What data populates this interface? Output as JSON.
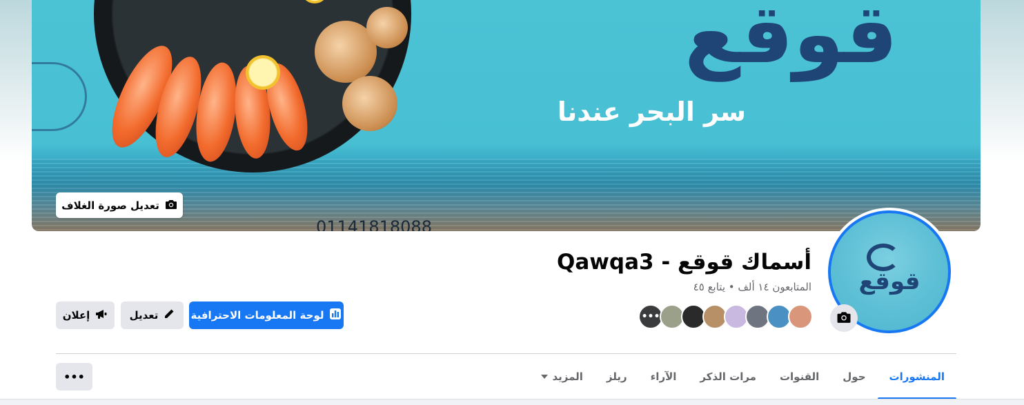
{
  "cover": {
    "logo_word": "قوقع",
    "tagline": "سر البحر عندنا",
    "phone": "01141818088",
    "edit_button_label": "تعديل صورة الغلاف",
    "edit_button_icon": "camera-icon"
  },
  "profile": {
    "avatar_mark": "قوقع",
    "avatar_camera_icon": "camera-icon",
    "name": "أسماك قوقع - Qawqa3",
    "followers_text": "المتابعون ١٤ ألف • يتابع ٤٥"
  },
  "friend_avatars": {
    "count_shown": 8,
    "more_label": "•••",
    "colors": [
      "#d9967a",
      "#4a90c2",
      "#6e7580",
      "#c9b8e0",
      "#b89068",
      "#2a2a2a",
      "#9aa08a",
      "#5a5e63"
    ]
  },
  "actions": {
    "dashboard_label": "لوحة المعلومات الاحترافية",
    "dashboard_icon": "chart-icon",
    "edit_label": "تعديل",
    "edit_icon": "pencil-icon",
    "ad_label": "إعلان",
    "ad_icon": "megaphone-icon",
    "primary_color": "#1877f2"
  },
  "tabs": [
    {
      "label": "المنشورات",
      "active": true
    },
    {
      "label": "حول",
      "active": false
    },
    {
      "label": "القنوات",
      "active": false
    },
    {
      "label": "مرات الذكر",
      "active": false
    },
    {
      "label": "الآراء",
      "active": false
    },
    {
      "label": "ريلز",
      "active": false
    },
    {
      "label": "المزيد",
      "active": false
    }
  ],
  "more_options_label": "•••"
}
